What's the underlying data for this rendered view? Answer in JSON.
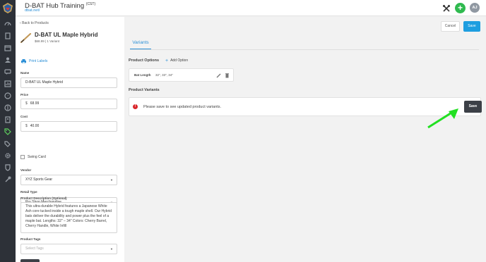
{
  "header": {
    "title": "D-BAT Hub Training",
    "timezone": "(CST)",
    "subdomain": "dbat.net/",
    "avatar_initials": "AJ",
    "add_symbol": "+"
  },
  "left": {
    "back_label": "Back to Products",
    "product_name": "D-BAT UL Maple Hybrid",
    "product_meta": "$68.99 | 1 Variant",
    "print_labels": "Print Labels",
    "name_label": "Name",
    "name_value": "D-BAT UL Maple Hybrid",
    "price_label": "Price",
    "price_value": "68.99",
    "cost_label": "Cost",
    "cost_value": "40.00",
    "currency": "$",
    "swing_card_label": "Swing Card",
    "vendor_label": "Vendor",
    "vendor_value": "XYZ Sports Gear",
    "retail_type_label": "Retail Type",
    "retail_type_value": "Pro Shop Merchandise",
    "description_label": "Product Description (Optional)",
    "description_value": "This ultra-durable Hybrid features a Japanese White Ash core tucked inside a tough maple shell. Our Hybrid bats deliver the durability and power plus the feel of a maple bat.  Lengths: 32\" – 34\" Colors: Cherry Barrel, Cherry Handle, White Infill",
    "tags_label": "Product Tags",
    "tags_placeholder": "Select Tags",
    "caret": "▼"
  },
  "main": {
    "cancel_label": "Cancel",
    "save_label": "Save",
    "tab_variants": "Variants",
    "product_options_title": "Product Options",
    "add_option_label": "Add Option",
    "add_option_symbol": "+",
    "option_name": "Bat Length",
    "option_values": "32\", 33\", 34\"",
    "product_variants_title": "Product Variants",
    "warning_symbol": "!",
    "warning_text": "Please save to see updated product variants.",
    "variant_save_label": "Save"
  },
  "colors": {
    "sidebar_bg": "#2d3138",
    "accent_blue": "#1e9ee0",
    "add_green": "#2fba4f",
    "annotation_arrow": "#22e022",
    "error_red": "#d9262b"
  }
}
